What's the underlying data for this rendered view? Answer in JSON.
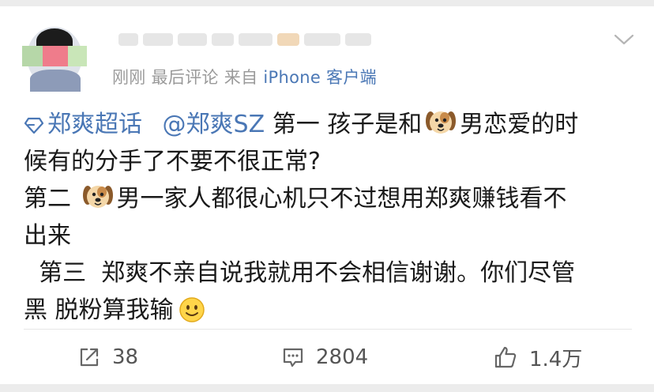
{
  "post": {
    "meta": {
      "time": "刚刚",
      "edit_label": "最后评论",
      "source_prefix": "来自",
      "source_app": "iPhone 客户端"
    },
    "topic_name": "郑爽超话",
    "mention": "@郑爽SZ",
    "content": {
      "line1_rest_a": " 第一 孩子是和",
      "line1_rest_b": "男恋爱的时",
      "line2": "候有的分手了不要不很正常?",
      "line3_a": "第二 ",
      "line3_b": "男一家人都很心机只不过想用郑爽赚钱看不",
      "line4": "出来",
      "line5": "  第三  郑爽不亲自说我就用不会相信谢谢。你们尽管",
      "line6": "黑 脱粉算我输"
    },
    "icons": {
      "topic": "diamond-topic-icon",
      "dog": "dog-emoji-icon",
      "smile": "smile-emoji-icon",
      "repost": "repost-icon",
      "comment": "comment-icon",
      "like": "thumbs-up-icon",
      "more": "chevron-down-icon"
    },
    "actions": {
      "repost_count": "38",
      "comment_count": "2804",
      "like_count": "1.4万"
    }
  },
  "colors": {
    "link": "#4a77b5",
    "meta_gray": "#9a9a9a",
    "text": "#1a1a1a"
  }
}
